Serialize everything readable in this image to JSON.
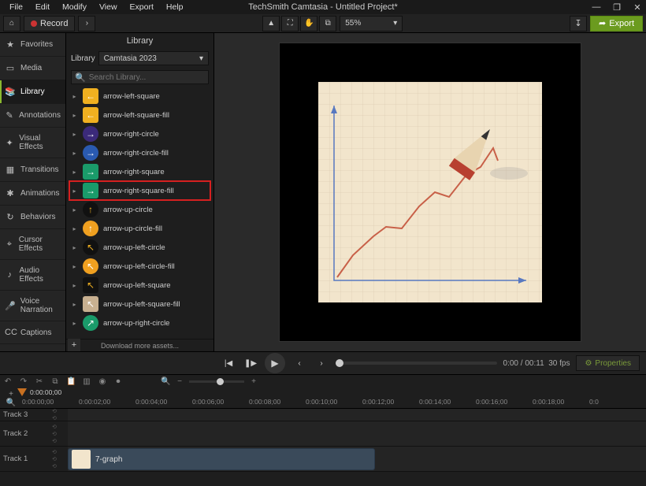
{
  "window": {
    "title": "TechSmith Camtasia - Untitled Project*",
    "menus": [
      "File",
      "Edit",
      "Modify",
      "View",
      "Export",
      "Help"
    ],
    "minimize": "—",
    "maximize": "❐",
    "close": "✕"
  },
  "toolbar": {
    "home": "⌂",
    "record": "Record",
    "chevron": "›",
    "pointer": "▲",
    "group": "⛶",
    "pan": "✋",
    "crop": "⧉",
    "zoom_value": "55%",
    "share": "↧",
    "export_icon": "➦",
    "export": "Export"
  },
  "sidebar": {
    "items": [
      {
        "icon": "★",
        "label": "Favorites"
      },
      {
        "icon": "▭",
        "label": "Media"
      },
      {
        "icon": "📚",
        "label": "Library"
      },
      {
        "icon": "✎",
        "label": "Annotations"
      },
      {
        "icon": "✦",
        "label": "Visual Effects"
      },
      {
        "icon": "▦",
        "label": "Transitions"
      },
      {
        "icon": "✱",
        "label": "Animations"
      },
      {
        "icon": "↻",
        "label": "Behaviors"
      },
      {
        "icon": "⌖",
        "label": "Cursor Effects"
      },
      {
        "icon": "♪",
        "label": "Audio Effects"
      },
      {
        "icon": "🎤",
        "label": "Voice Narration"
      },
      {
        "icon": "CC",
        "label": "Captions"
      }
    ],
    "active_index": 2
  },
  "library": {
    "title": "Library",
    "selector_label": "Library",
    "selector_value": "Camtasia 2023",
    "search_placeholder": "Search Library...",
    "search_icon": "🔍",
    "assets": [
      {
        "name": "arrow-left-square",
        "bg": "#f0b020",
        "shape": "sq",
        "arrow": "←"
      },
      {
        "name": "arrow-left-square-fill",
        "bg": "#f0b020",
        "shape": "sq",
        "arrow": "←"
      },
      {
        "name": "arrow-right-circle",
        "bg": "#3b2a7a",
        "shape": "ci",
        "arrow": "→"
      },
      {
        "name": "arrow-right-circle-fill",
        "bg": "#2a5ab0",
        "shape": "ci",
        "arrow": "→"
      },
      {
        "name": "arrow-right-square",
        "bg": "#1a9b6a",
        "shape": "sq",
        "arrow": "→"
      },
      {
        "name": "arrow-right-square-fill",
        "bg": "#1a9b6a",
        "shape": "sq",
        "arrow": "→",
        "highlight": true
      },
      {
        "name": "arrow-up-circle",
        "bg": "#111",
        "shape": "ci",
        "arrow": "↑",
        "fg": "#f0b020"
      },
      {
        "name": "arrow-up-circle-fill",
        "bg": "#f0a020",
        "shape": "ci",
        "arrow": "↑"
      },
      {
        "name": "arrow-up-left-circle",
        "bg": "#111",
        "shape": "ci",
        "arrow": "↖",
        "fg": "#f0b020"
      },
      {
        "name": "arrow-up-left-circle-fill",
        "bg": "#f0a020",
        "shape": "ci",
        "arrow": "↖"
      },
      {
        "name": "arrow-up-left-square",
        "bg": "#111",
        "shape": "sq",
        "arrow": "↖",
        "fg": "#f0b020"
      },
      {
        "name": "arrow-up-left-square-fill",
        "bg": "#c8b090",
        "shape": "sq",
        "arrow": "↖"
      },
      {
        "name": "arrow-up-right-circle",
        "bg": "#1a9b6a",
        "shape": "ci",
        "arrow": "↗"
      }
    ],
    "download_more": "Download more assets...",
    "add": "+"
  },
  "playback": {
    "prev": "|◀",
    "step_back": "❚▶",
    "play": "▶",
    "back": "‹",
    "fwd": "›",
    "time_current": "0:00",
    "time_sep": "/",
    "time_total": "00:11",
    "fps": "30 fps",
    "properties": "Properties",
    "prop_icon": "⚙"
  },
  "editbar": {
    "undo": "↶",
    "redo": "↷",
    "cut": "✂",
    "copy": "⧉",
    "paste": "📋",
    "split": "▥",
    "marker": "◉",
    "rec_mini": "⏺",
    "mag": "🔍",
    "minus": "−",
    "plus": "+"
  },
  "timeline": {
    "tool_plus": "+",
    "tool_mag": "🔍",
    "playhead_time": "0:00:00;00",
    "ticks": [
      "0:00:00;00",
      "0:00:02;00",
      "0:00:04;00",
      "0:00:06;00",
      "0:00:08;00",
      "0:00:10;00",
      "0:00:12;00",
      "0:00:14;00",
      "0:00:16;00",
      "0:00:18;00",
      "0:0"
    ],
    "tracks": [
      {
        "label": "Track 3"
      },
      {
        "label": "Track 2"
      },
      {
        "label": "Track 1",
        "clip": {
          "name": "7-graph"
        }
      }
    ]
  }
}
